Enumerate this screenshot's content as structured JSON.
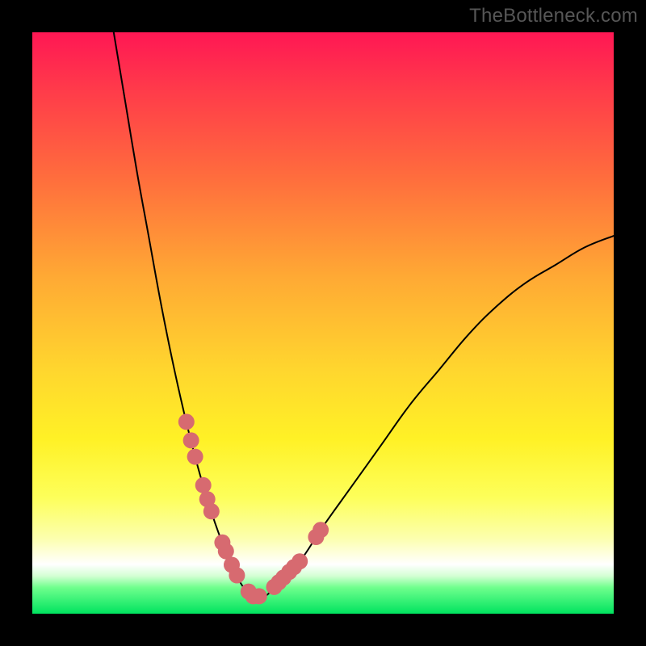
{
  "watermark": "TheBottleneck.com",
  "colors": {
    "background_frame": "#000000",
    "gradient_top": "#ff1754",
    "gradient_mid": "#ffd62e",
    "gradient_white_band": "#ffffff",
    "gradient_bottom": "#00e35f",
    "curve_stroke": "#000000",
    "bead_fill": "#d76a70"
  },
  "chart_data": {
    "type": "line",
    "title": "",
    "xlabel": "",
    "ylabel": "",
    "xlim": [
      0,
      100
    ],
    "ylim": [
      0,
      100
    ],
    "grid": false,
    "legend": false,
    "notes": "Bottleneck-style V-curve. Y axis is inverted visually (0 at top of colored panel, 100 at bottom). Values below are (x, y) where higher y means lower on screen (closer to green). Minimum of the curve (~y≈97) sits around x≈36.",
    "series": [
      {
        "name": "curve",
        "x": [
          14,
          16,
          18,
          20,
          22,
          24,
          26,
          28,
          30,
          32,
          34,
          36,
          38,
          40,
          42,
          46,
          50,
          55,
          60,
          65,
          70,
          75,
          80,
          85,
          90,
          95,
          100
        ],
        "y": [
          0,
          12,
          24,
          35,
          46,
          56,
          65,
          73,
          80,
          86,
          91,
          95,
          97,
          97,
          95,
          91,
          85,
          78,
          71,
          64,
          58,
          52,
          47,
          43,
          40,
          37,
          35
        ]
      }
    ],
    "bead_markers": {
      "description": "Salmon circular markers clustered along the lower V portion of the curve",
      "left_arm_x": [
        26.5,
        27.3,
        28.0,
        29.4,
        30.1,
        30.8,
        32.7,
        33.3,
        34.3,
        35.2
      ],
      "right_arm_x": [
        37.2,
        38.0,
        39.0,
        41.6,
        42.4,
        43.2,
        44.2,
        45.0,
        46.0,
        48.8,
        49.6
      ],
      "radius_px": 10
    }
  }
}
